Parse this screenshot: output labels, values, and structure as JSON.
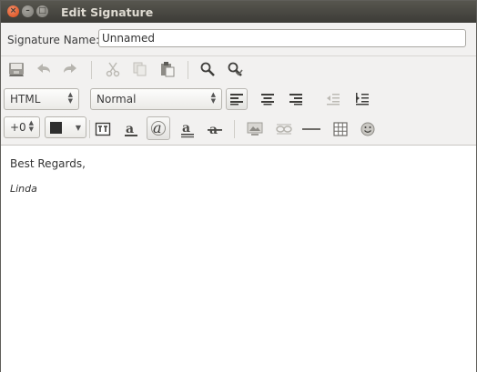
{
  "window": {
    "title": "Edit Signature",
    "close_glyph": "×",
    "minimize_glyph": "–",
    "maximize_glyph": "□"
  },
  "name_row": {
    "label": "Signature Name:",
    "value": "Unnamed"
  },
  "toolbar1": {
    "icons": [
      "save-icon",
      "undo-icon",
      "redo-icon",
      "cut-icon",
      "copy-icon",
      "paste-icon",
      "find-icon",
      "find-replace-icon"
    ]
  },
  "toolbar2": {
    "format_mode": "HTML",
    "paragraph_style": "Normal",
    "icons": [
      "align-left-icon",
      "align-center-icon",
      "align-right-icon",
      "indent-decrease-icon",
      "indent-increase-icon"
    ]
  },
  "toolbar3": {
    "font_size": "+0",
    "text_color": "#2e2e2e",
    "icons": [
      "teletype-icon",
      "bold-icon",
      "italic-icon",
      "underline-icon",
      "strikethrough-icon",
      "insert-image-icon",
      "insert-link-icon",
      "insert-rule-icon",
      "insert-table-icon",
      "insert-emoticon-icon"
    ]
  },
  "editor": {
    "line1": "Best Regards,",
    "line2": "Linda"
  },
  "colors": {
    "titlebar": "#3c3b37",
    "close_button": "#dd4814",
    "selection": "#f07746"
  }
}
